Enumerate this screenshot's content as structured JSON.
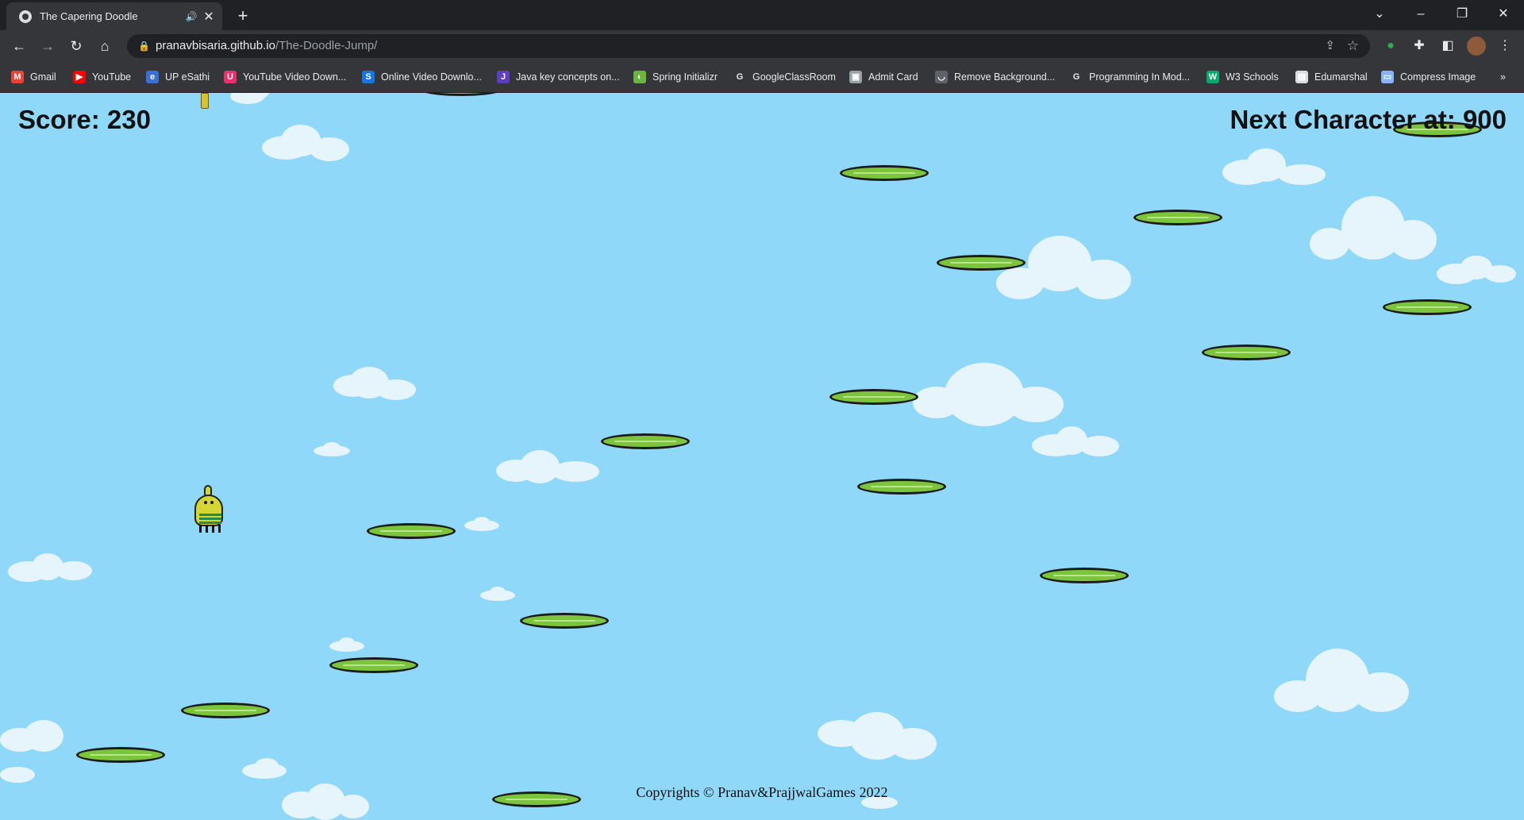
{
  "browser": {
    "tab_title": "The Capering Doodle",
    "new_tab_symbol": "+",
    "url_host": "pranavbisaria.github.io",
    "url_path": "/The-Doodle-Jump/",
    "bookmarks": [
      {
        "label": "Gmail",
        "icon": "gmail-icon",
        "color": "#ea4335",
        "glyph": "M"
      },
      {
        "label": "YouTube",
        "icon": "youtube-icon",
        "color": "#ff0000",
        "glyph": "▶"
      },
      {
        "label": "UP eSathi",
        "icon": "esathi-icon",
        "color": "#3b6fd6",
        "glyph": "e"
      },
      {
        "label": "YouTube Video Down...",
        "icon": "youtube-downloader-icon",
        "color": "#e8316b",
        "glyph": "U"
      },
      {
        "label": "Online Video Downlo...",
        "icon": "online-video-downloader-icon",
        "color": "#1a73e8",
        "glyph": "S"
      },
      {
        "label": "Java key concepts on...",
        "icon": "java-icon",
        "color": "#5b3fc0",
        "glyph": "J"
      },
      {
        "label": "Spring Initializr",
        "icon": "spring-icon",
        "color": "#6db33f",
        "glyph": "◐"
      },
      {
        "label": "GoogleClassRoom",
        "icon": "google-icon",
        "color": "#ffffff",
        "glyph": "G"
      },
      {
        "label": "Admit Card",
        "icon": "admit-card-icon",
        "color": "#9aa0a6",
        "glyph": "▣"
      },
      {
        "label": "Remove Background...",
        "icon": "remove-bg-icon",
        "color": "#5f6368",
        "glyph": "◡"
      },
      {
        "label": "Programming In Mod...",
        "icon": "google-icon",
        "color": "#ffffff",
        "glyph": "G"
      },
      {
        "label": "W3 Schools",
        "icon": "w3schools-icon",
        "color": "#04aa6d",
        "glyph": "W"
      },
      {
        "label": "Edumarshal",
        "icon": "edumarshal-icon",
        "color": "#dadce0",
        "glyph": "▤"
      },
      {
        "label": "Compress Image",
        "icon": "compress-image-icon",
        "color": "#8ab4f8",
        "glyph": "▭"
      }
    ],
    "bookmarks_overflow": "»"
  },
  "game": {
    "score_label": "Score: ",
    "score_value": "230",
    "next_character_label": "Next Character at: ",
    "next_character_value": "900",
    "copyright": "Copyrights © Pranav&PrajjwalGames 2022",
    "colors": {
      "sky": "#8fd8f9",
      "platform": "#7cc43b",
      "platform_outline": "#1b1b1b",
      "doodle_body": "#d6d630"
    }
  }
}
